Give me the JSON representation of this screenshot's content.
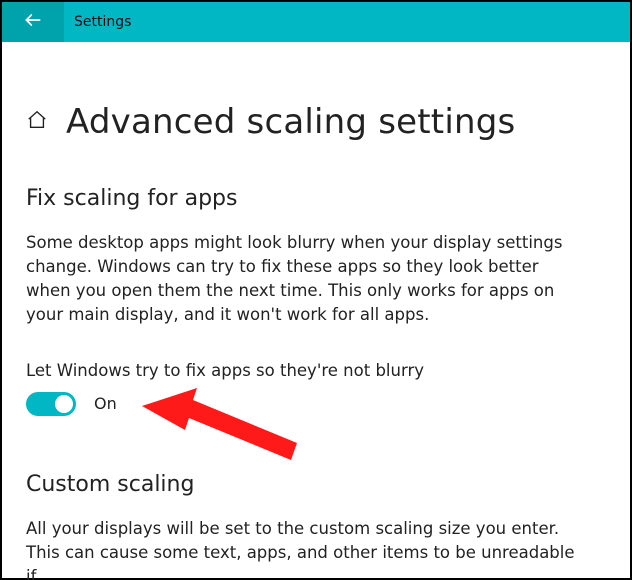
{
  "header": {
    "title": "Settings"
  },
  "page": {
    "title": "Advanced scaling settings"
  },
  "sections": {
    "fix_scaling": {
      "heading": "Fix scaling for apps",
      "description": "Some desktop apps might look blurry when your display settings change. Windows can try to fix these apps so they look better when you open them the next time. This only works for apps on your main display, and it won't work for all apps.",
      "toggle_label": "Let Windows try to fix apps so they're not blurry",
      "toggle_state": "On"
    },
    "custom_scaling": {
      "heading": "Custom scaling",
      "description": "All your displays will be set to the custom scaling size you enter. This can cause some text, apps, and other items to be unreadable if"
    }
  },
  "colors": {
    "accent": "#00b7c3",
    "annotation": "#ff1a1a"
  }
}
